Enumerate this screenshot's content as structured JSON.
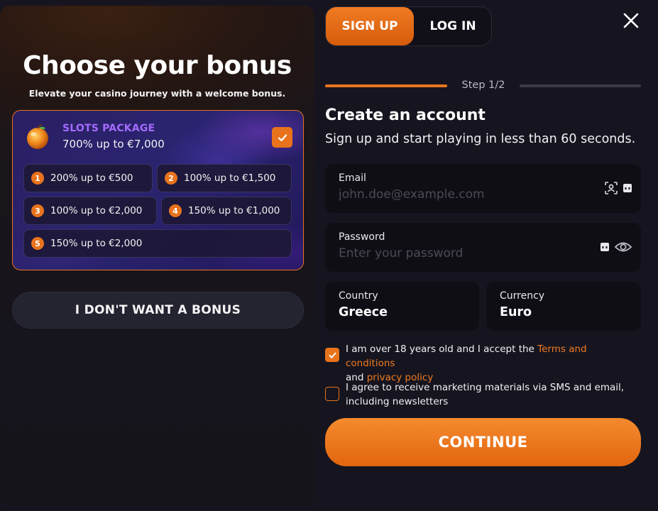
{
  "colors": {
    "accent": "#e8731c",
    "background": "#16151f",
    "package_name": "#a46bff"
  },
  "bonus": {
    "title": "Choose your bonus",
    "subtitle": "Elevate your casino journey with a welcome bonus.",
    "package": {
      "name": "SLOTS PACKAGE",
      "amount": "700% up to €7,000",
      "icon": "orange-fruit-icon",
      "selected": true
    },
    "items": [
      {
        "num": "1",
        "label": "200% up to €500"
      },
      {
        "num": "2",
        "label": "100% up to €1,500"
      },
      {
        "num": "3",
        "label": "100% up to €2,000"
      },
      {
        "num": "4",
        "label": "150% up to €1,000"
      },
      {
        "num": "5",
        "label": "150% up to €2,000"
      }
    ],
    "no_bonus_label": "I DON'T WANT A BONUS"
  },
  "tabs": {
    "signup": "SIGN UP",
    "login": "LOG IN"
  },
  "step": {
    "label": "Step 1/2"
  },
  "form": {
    "title": "Create an account",
    "subtitle": "Sign up and start playing in less than 60 seconds.",
    "email": {
      "label": "Email",
      "placeholder": "john.doe@example.com",
      "value": ""
    },
    "password": {
      "label": "Password",
      "placeholder": "Enter your password",
      "value": ""
    },
    "country": {
      "label": "Country",
      "value": "Greece"
    },
    "currency": {
      "label": "Currency",
      "value": "Euro"
    },
    "consent_age": {
      "checked": true,
      "text_before": "I am over 18 years old and I accept the ",
      "terms_link": "Terms and conditions",
      "text_and": "and ",
      "privacy_link": "privacy policy"
    },
    "consent_marketing": {
      "checked": false,
      "text": "I agree to receive marketing materials via SMS and email, including newsletters"
    },
    "continue_label": "CONTINUE"
  }
}
